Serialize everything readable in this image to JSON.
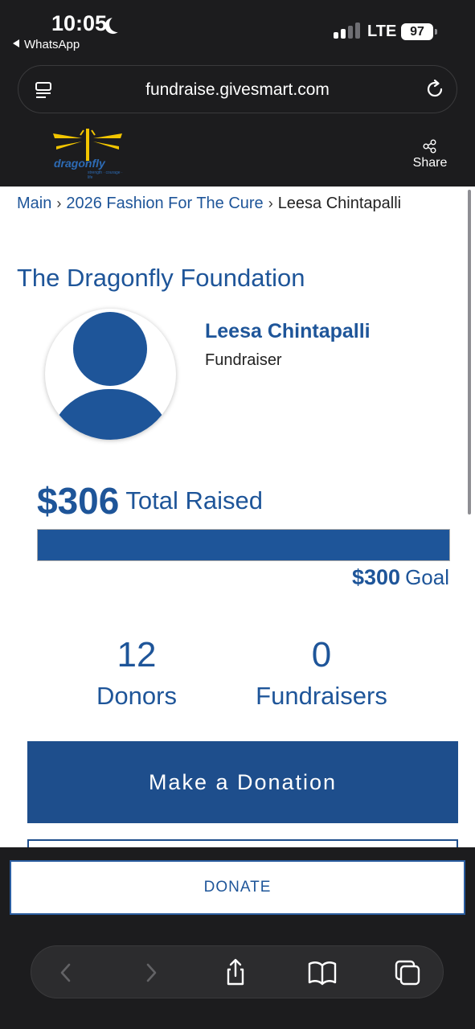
{
  "status_bar": {
    "time": "10:05",
    "back_app": "WhatsApp",
    "network": "LTE",
    "battery": "97"
  },
  "browser": {
    "url": "fundraise.givesmart.com"
  },
  "site_header": {
    "logo_word": "dragonfly",
    "logo_tagline": "strength · courage · life",
    "share_label": "Share"
  },
  "breadcrumb": {
    "main": "Main",
    "event": "2026 Fashion For The Cure",
    "current": "Leesa Chintapalli"
  },
  "organization": "The Dragonfly Foundation",
  "fundraiser": {
    "name": "Leesa Chintapalli",
    "role": "Fundraiser"
  },
  "totals": {
    "raised_amount": "$306",
    "raised_label": "Total Raised",
    "goal_amount": "$300",
    "goal_label": "Goal",
    "progress_fraction": 1.0
  },
  "stats": {
    "donors_count": "12",
    "donors_label": "Donors",
    "fundraisers_count": "0",
    "fundraisers_label": "Fundraisers"
  },
  "buttons": {
    "make_donation": "Make a Donation",
    "donate_bar": "DONATE"
  },
  "colors": {
    "brand_blue": "#1e5599",
    "button_blue": "#1e4e8c",
    "dark_chrome": "#1c1c1e"
  }
}
